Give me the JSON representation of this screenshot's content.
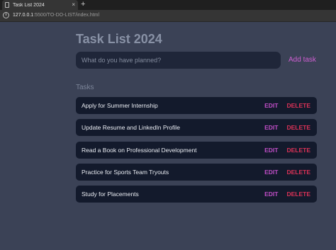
{
  "browser": {
    "tab_title": "Task List 2024",
    "tab_close": "×",
    "new_tab": "+",
    "url_host": "127.0.0.1",
    "url_path": ":5500/TO-DO-LIST/index.html"
  },
  "app": {
    "title": "Task List 2024",
    "input": {
      "placeholder": "What do you have planned?",
      "value": ""
    },
    "add_label": "Add task",
    "tasks_heading": "Tasks",
    "edit_label": "EDIT",
    "delete_label": "DELETE",
    "tasks": [
      "Apply for Summer Internship",
      "Update Resume and LinkedIn Profile",
      "Read a Book on Professional Development",
      "Practice for Sports Team Tryouts",
      "Study for Placements"
    ]
  },
  "colors": {
    "page_bg": "#3b4256",
    "card_bg": "#131a2c",
    "accent": "#c04ec7",
    "danger": "#dc3257"
  }
}
